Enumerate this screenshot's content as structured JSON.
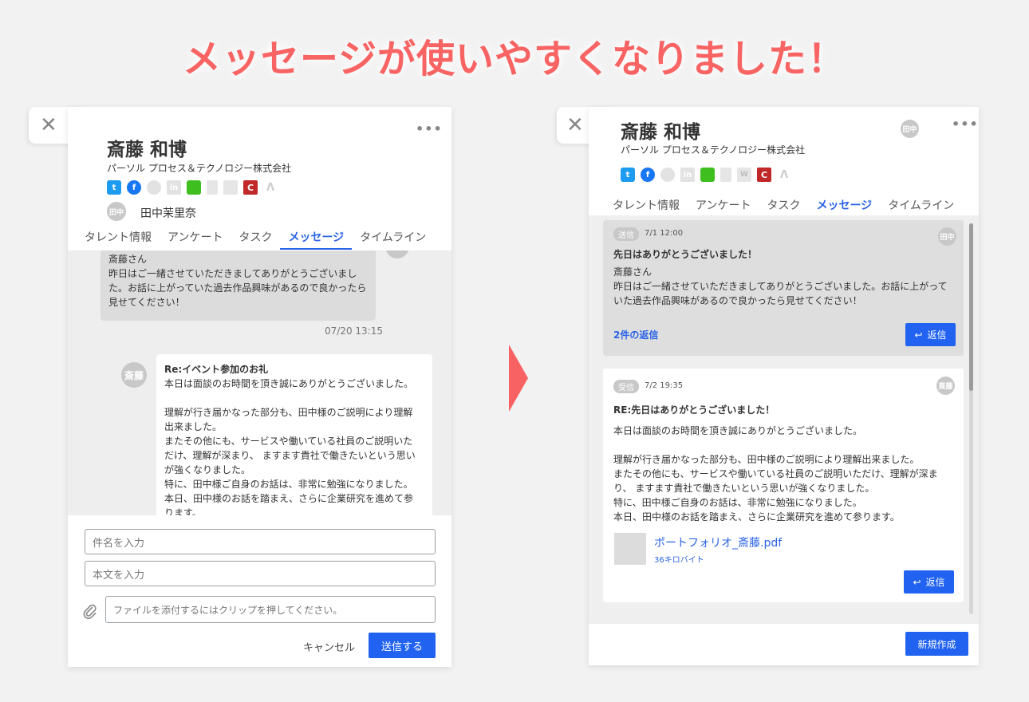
{
  "headline": "メッセージが使いやすくなりました！",
  "icons": [
    "close-icon",
    "more-icon",
    "twitter-icon",
    "facebook-icon",
    "github-icon",
    "linkedin-icon",
    "chat-icon",
    "doc-icon",
    "mail-icon",
    "wantedly-icon",
    "cc-icon",
    "lambda-icon",
    "paperclip-icon",
    "reply-icon"
  ],
  "colors": {
    "headline": "#f86464",
    "accent": "#2163f0",
    "arrow": "#f96262"
  },
  "profile": {
    "name": "斎藤 和博",
    "company": "パーソル プロセス＆テクノロジー株式会社",
    "recruiter": "田中茉里奈",
    "recruiter_avatar": "田中",
    "candidate_avatar": "斎藤",
    "wt_label": "W",
    "cc_label": "C",
    "lm_label": "Λ",
    "li_label": "in",
    "more": "•••",
    "close": "✕"
  },
  "tabs": [
    "タレント情報",
    "アンケート",
    "タスク",
    "メッセージ",
    "タイムライン"
  ],
  "old": {
    "msg1": {
      "lines": [
        "斎藤さん",
        "昨日はご一緒させていただきましてありがとうございまし",
        "た。お話に上がっていた過去作品興味があるので良かったら",
        "見せてください！"
      ],
      "time": "07/20 13:15"
    },
    "msg2": {
      "subject": "Re:イベント参加のお礼",
      "lines": [
        "本日は面談のお時間を頂き誠にありがとうございました。",
        "",
        "理解が行き届かなった部分も、田中様のご説明により理解",
        "出来ました。",
        "またその他にも、サービスや働いている社員のご説明いた",
        "だけ、理解が深まり、 ますます貴社で働きたいという思い",
        "が強くなりました。",
        "特に、田中様ご自身のお話は、非常に勉強になりました。",
        "本日、田中様のお話を踏まえ、さらに企業研究を進めて参",
        "ります。"
      ]
    },
    "subject_placeholder": "件名を入力",
    "body_placeholder": "本文を入力",
    "file_placeholder": "ファイルを添付するにはクリップを押してください。",
    "cancel": "キャンセル",
    "send": "送信する"
  },
  "new": {
    "card1": {
      "badge": "送信",
      "time": "7/1 12:00",
      "avatar": "田中",
      "subject": "先日はありがとうございました！",
      "lines": [
        "斎藤さん",
        "昨日はご一緒させていただきましてありがとうございました。お話に上がって",
        "いた過去作品興味があるので良かったら見せてください！"
      ],
      "replies": "2件の返信",
      "reply": "返信"
    },
    "card2": {
      "badge": "受信",
      "time": "7/2 19:35",
      "avatar": "斎藤",
      "subject": "RE:先日はありがとうございました！",
      "lines": [
        "本日は面談のお時間を頂き誠にありがとうございました。",
        "",
        "理解が行き届かなった部分も、田中様のご説明により理解出来ました。",
        "またその他にも、サービスや働いている社員のご説明いただけ、理解が深ま",
        "り、 ますます貴社で働きたいという思いが強くなりました。",
        "特に、田中様ご自身のお話は、非常に勉強になりました。",
        "本日、田中様のお話を踏まえ、さらに企業研究を進めて参ります。"
      ],
      "file_name": "ポートフォリオ_斎藤.pdf",
      "file_size": "36キロバイト",
      "reply": "返信"
    },
    "new_button": "新規作成"
  }
}
